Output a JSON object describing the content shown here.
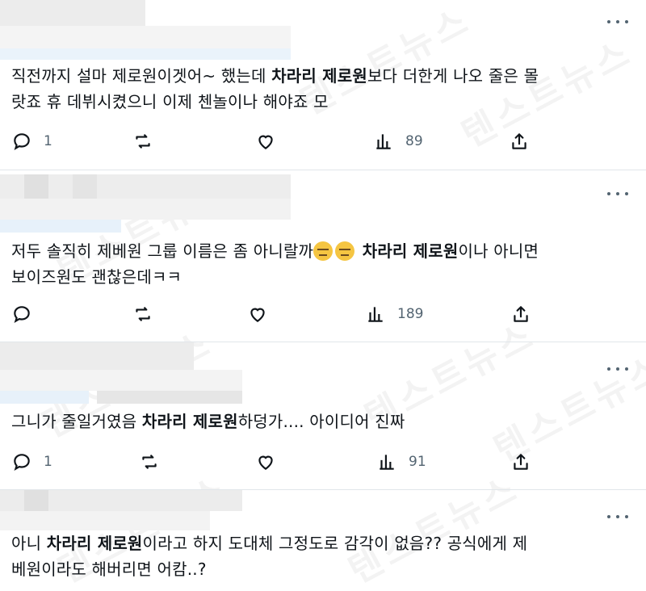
{
  "tweets": [
    {
      "segments": [
        {
          "text": "직전까지 설마 제로원이겟어~ 했는데 ",
          "bold": false
        },
        {
          "text": "차라리 제로원",
          "bold": true
        },
        {
          "text": "보다 더한게 나오 줄은 몰",
          "bold": false
        }
      ],
      "line2": "랏죠 휴 데뷔시켰으니 이제 첸놀이나 해야죠 모",
      "replies": "1",
      "views": "89"
    },
    {
      "line1a": "저두 솔직히 제베원 그룹 이름은 좀 아니랄까",
      "line1b": "차라리 제로원",
      "line1c": "이나 아니면",
      "line2": "보이즈원도 괜찮은데ㅋㅋ",
      "replies": "",
      "views": "189"
    },
    {
      "line1a": "그니가 줄일거였음 ",
      "line1b": "차라리 제로원",
      "line1c": "하덩가.... 아이디어 진짜",
      "replies": "1",
      "views": "91"
    },
    {
      "line1a": "아니 ",
      "line1b": "차라리 제로원",
      "line1c": "이라고 하지 도대체 그정도로 감각이 없음?? 공식에게 제",
      "line2": "베원이라도 해버리면 어캄..?"
    }
  ],
  "icons": {
    "reply": "reply-icon",
    "retweet": "retweet-icon",
    "like": "like-icon",
    "views": "views-icon",
    "share": "share-icon",
    "more": "more-icon"
  },
  "watermark": "텐스트뉴스"
}
